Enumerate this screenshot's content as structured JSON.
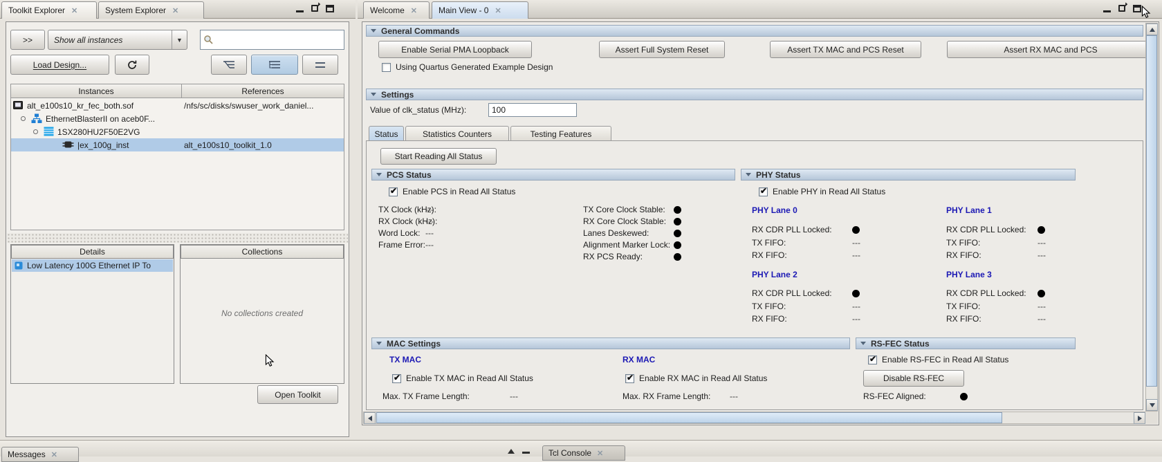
{
  "colors": {
    "accent_blue": "#1c19b4",
    "selection": "#b0cbe7",
    "section_header": "#bfd0e2",
    "status_dot": "#000000"
  },
  "icons": {
    "close": "✕",
    "dropdown_arrow": "▼"
  },
  "left_pane": {
    "tabs": [
      {
        "label": "Toolkit Explorer"
      },
      {
        "label": "System Explorer"
      }
    ],
    "toolbar": {
      "more_button": ">>",
      "filter_value": "Show all instances",
      "load_design_button": "Load Design...",
      "search_value": ""
    },
    "table": {
      "headers": [
        "Instances",
        "References"
      ],
      "rows": [
        {
          "instance": "alt_e100s10_kr_fec_both.sof",
          "reference": "/nfs/sc/disks/swuser_work_daniel..."
        },
        {
          "instance": "EthernetBlasterII on aceb0F...",
          "reference": ""
        },
        {
          "instance": "1SX280HU2F50E2VG",
          "reference": ""
        },
        {
          "instance": "|ex_100g_inst",
          "reference": "alt_e100s10_toolkit_1.0"
        }
      ]
    },
    "details": {
      "header": "Details",
      "item": "Low Latency 100G Ethernet IP To"
    },
    "collections": {
      "header": "Collections",
      "empty_text": "No collections created"
    },
    "open_toolkit_button": "Open Toolkit"
  },
  "right_pane": {
    "tabs": [
      {
        "label": "Welcome"
      },
      {
        "label": "Main View - 0"
      }
    ],
    "general_commands": {
      "title": "General Commands",
      "buttons": [
        "Enable Serial PMA Loopback",
        "Assert Full System Reset",
        "Assert TX MAC and PCS Reset",
        "Assert RX MAC and PCS"
      ],
      "checkbox_label": "Using Quartus Generated Example Design"
    },
    "settings": {
      "title": "Settings",
      "clk_label": "Value of clk_status (MHz):",
      "clk_value": "100",
      "tabs": [
        "Status",
        "Statistics Counters",
        "Testing Features"
      ],
      "start_button": "Start Reading All Status"
    },
    "pcs_status": {
      "title": "PCS Status",
      "enable_label": "Enable PCS in Read All Status",
      "left_rows": [
        {
          "label": "TX Clock (kHz):",
          "value": "---"
        },
        {
          "label": "RX Clock (kHz):",
          "value": "---"
        },
        {
          "label": "Word Lock:",
          "value": "---"
        },
        {
          "label": "Frame Error:",
          "value": "---"
        }
      ],
      "right_rows": [
        "TX Core Clock Stable:",
        "RX Core Clock Stable:",
        "Lanes Deskewed:",
        "Alignment Marker Lock:",
        "RX PCS Ready:"
      ]
    },
    "phy_status": {
      "title": "PHY Status",
      "enable_label": "Enable PHY in Read All Status",
      "lanes": [
        "PHY Lane 0",
        "PHY Lane 1",
        "PHY Lane 2",
        "PHY Lane 3"
      ],
      "row_labels": {
        "cdr": "RX CDR PLL Locked:",
        "txfifo": "TX FIFO:",
        "rxfifo": "RX FIFO:"
      },
      "dash": "---"
    },
    "mac_settings": {
      "title": "MAC Settings",
      "tx_title": "TX MAC",
      "rx_title": "RX MAC",
      "tx_enable": "Enable TX MAC in Read All Status",
      "rx_enable": "Enable RX MAC in Read All Status",
      "tx_frame_label": "Max. TX Frame Length:",
      "rx_frame_label": "Max. RX Frame Length:",
      "tx_frame_value": "---",
      "rx_frame_value": "---"
    },
    "rsfec_status": {
      "title": "RS-FEC Status",
      "enable_label": "Enable RS-FEC in Read All Status",
      "disable_button": "Disable RS-FEC",
      "aligned_label": "RS-FEC Aligned:"
    }
  },
  "bottom_pane": {
    "tabs": [
      {
        "label": "Messages"
      },
      {
        "label": "Tcl Console"
      }
    ]
  }
}
